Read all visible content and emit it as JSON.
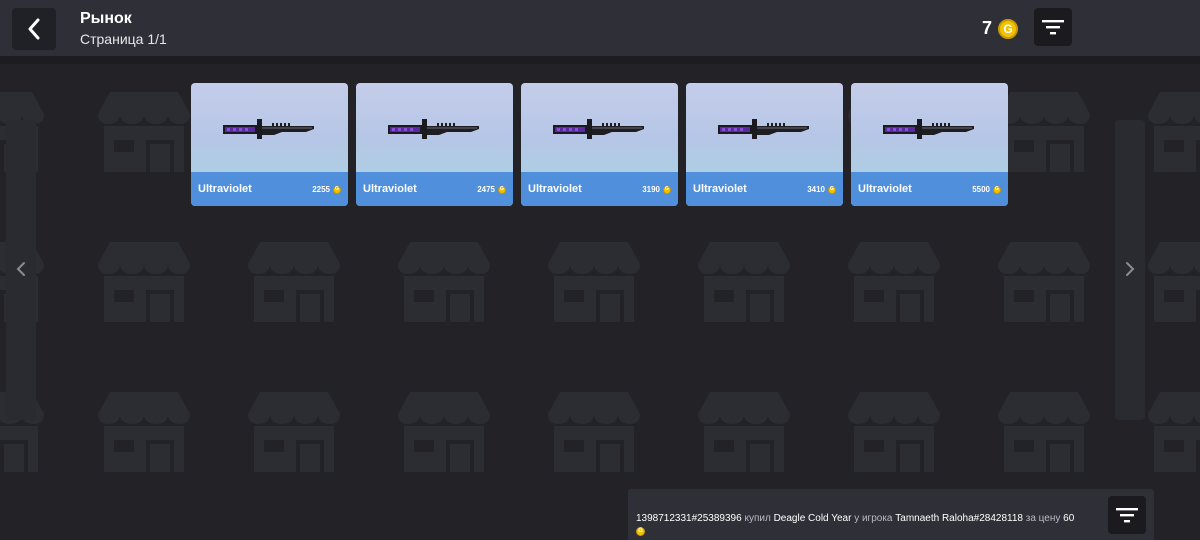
{
  "header": {
    "title": "Рынок",
    "subtitle": "Страница 1/1",
    "currency_amount": "7",
    "currency_icon": "gold-coin-icon",
    "coin_symbol": "G"
  },
  "items": [
    {
      "name": "Ultraviolet",
      "price": "2255"
    },
    {
      "name": "Ultraviolet",
      "price": "2475"
    },
    {
      "name": "Ultraviolet",
      "price": "3190"
    },
    {
      "name": "Ultraviolet",
      "price": "3410"
    },
    {
      "name": "Ultraviolet",
      "price": "5500"
    }
  ],
  "log": {
    "buyer": "1398712331#25389396",
    "action": "купил",
    "item": "Deagle Cold Year",
    "from_text": "у игрока",
    "seller": "Tamnaeth Raloha#28428118",
    "price_text": "за цену",
    "price": "60"
  },
  "colors": {
    "background": "#222227",
    "header": "#2f3037",
    "card_footer": "#4f8fdc",
    "coin": "#f2c200"
  }
}
